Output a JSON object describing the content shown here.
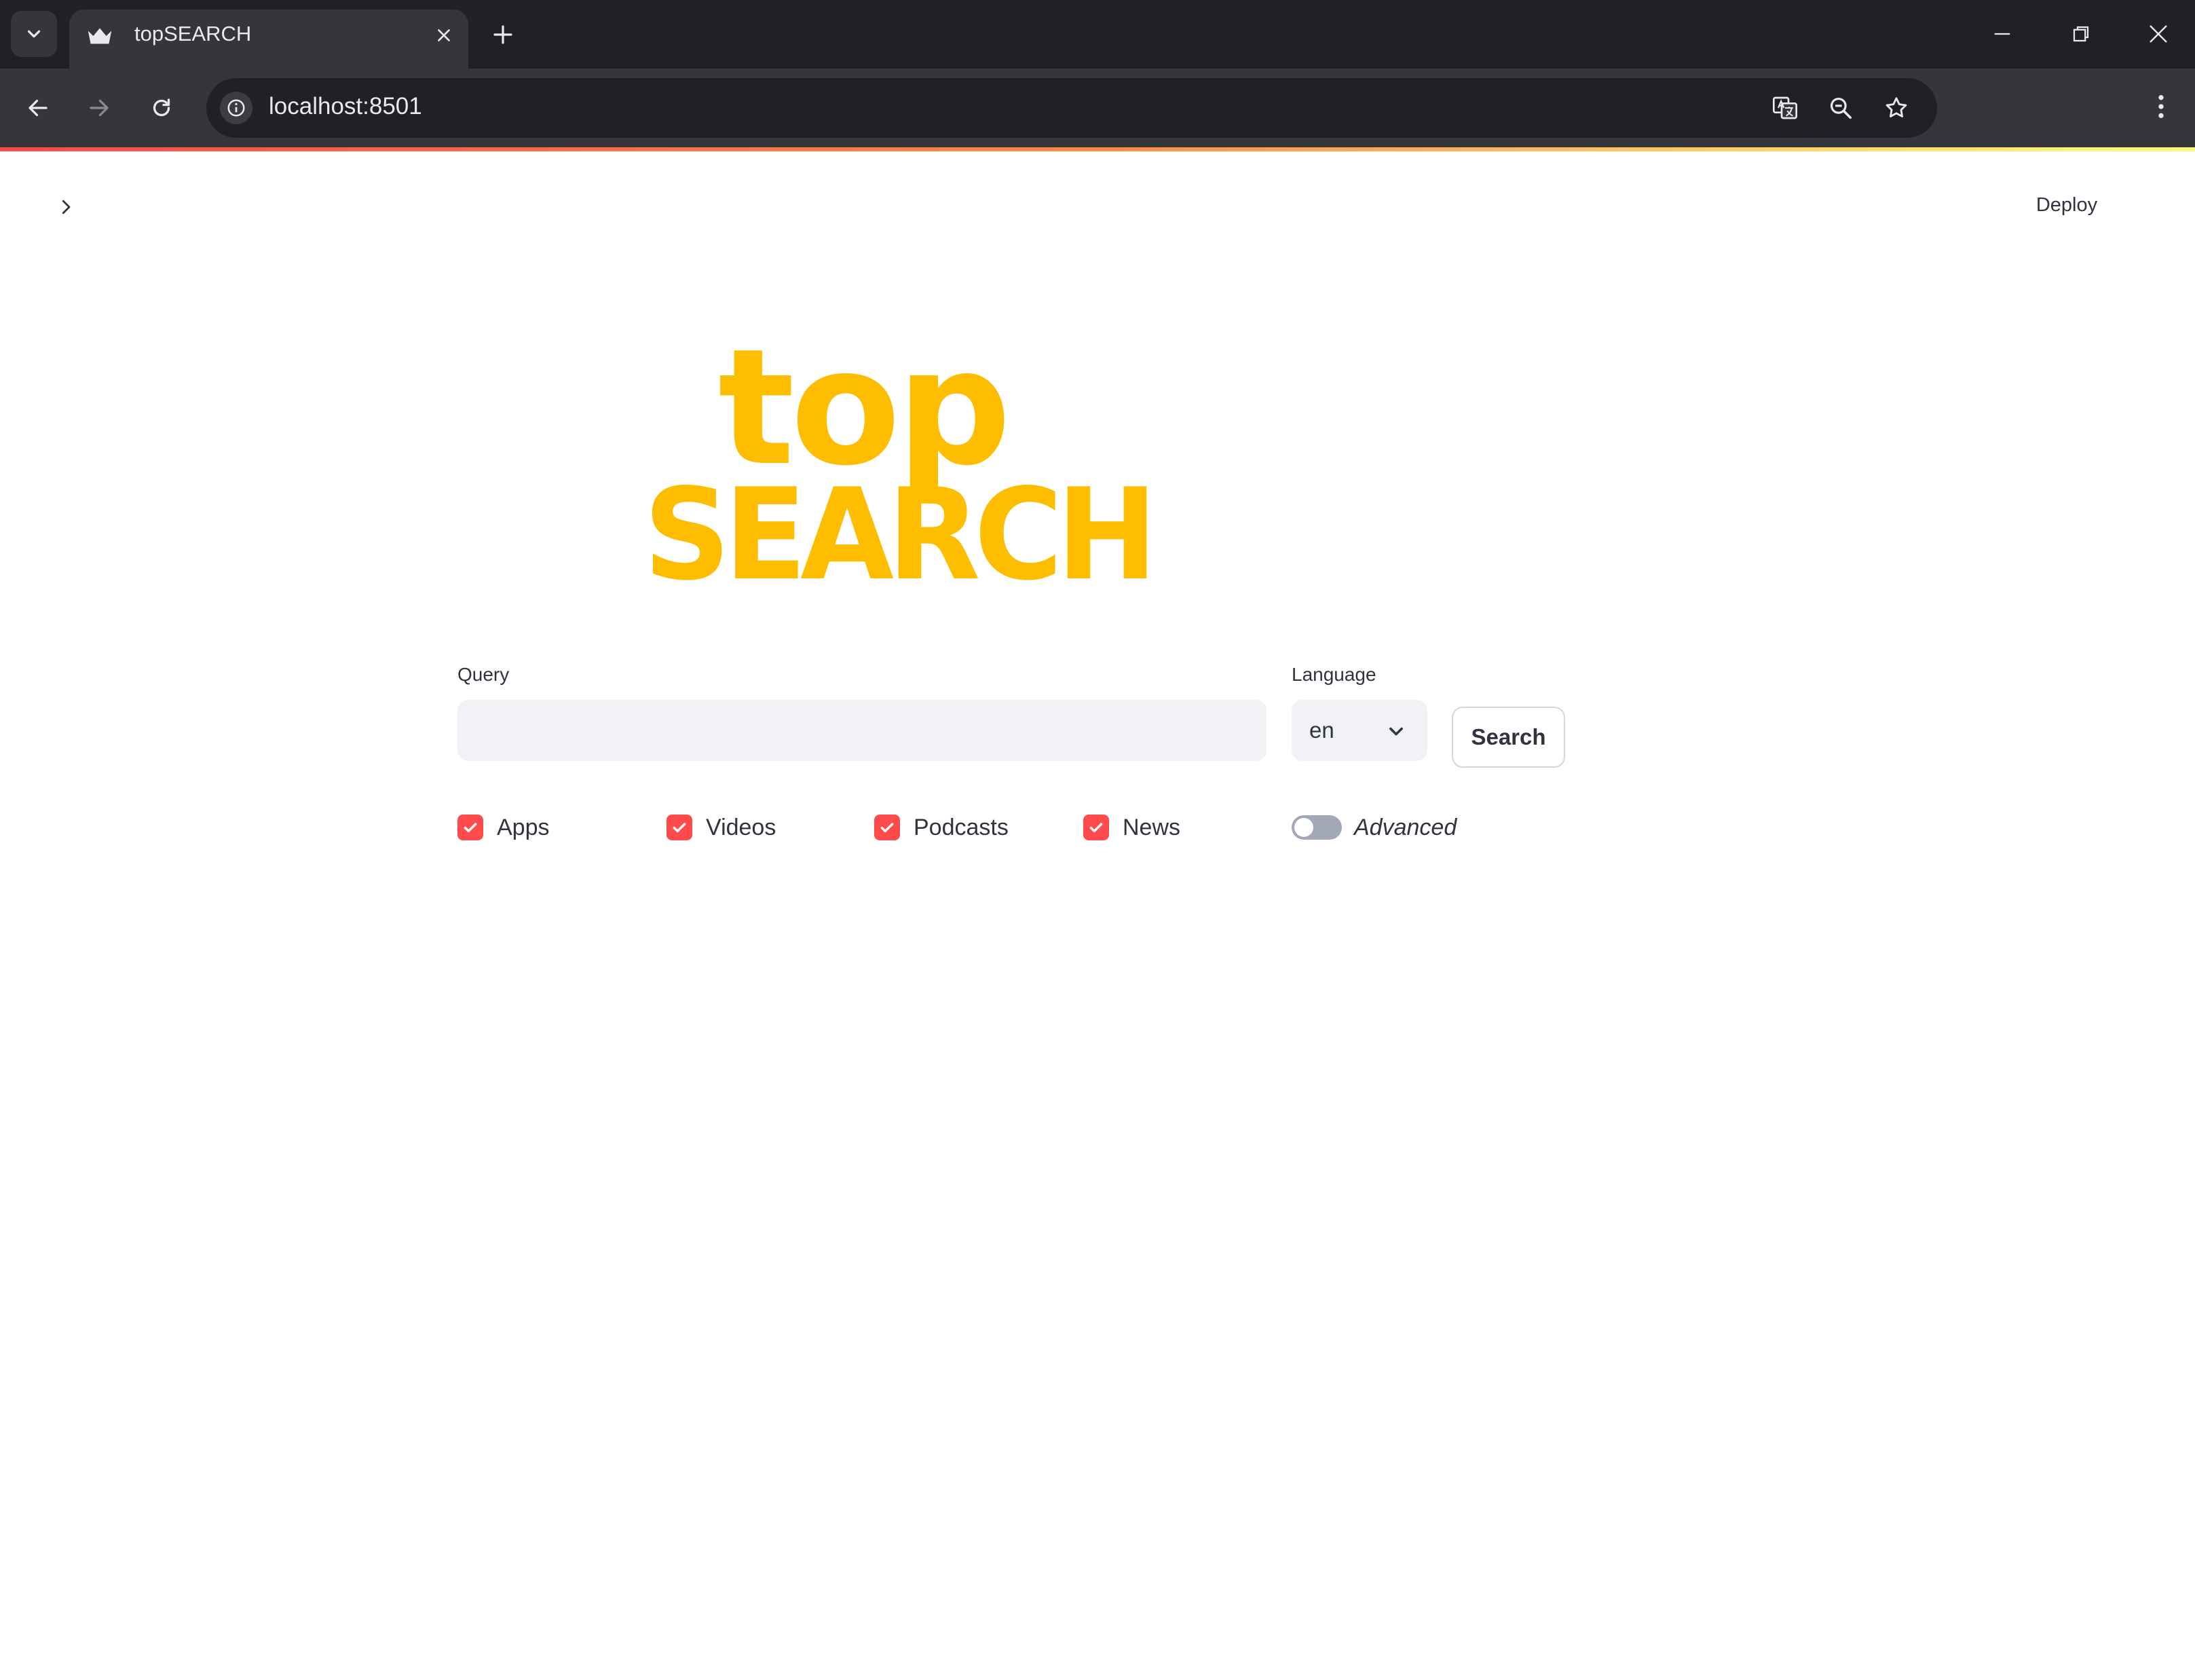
{
  "browser": {
    "tab_title": "topSEARCH",
    "url": "localhost:8501",
    "icons": [
      "tab-search-icon",
      "crown-favicon-icon",
      "close-icon",
      "plus-icon",
      "minimize-icon",
      "restore-icon",
      "window-close-icon",
      "back-arrow-icon",
      "forward-arrow-icon",
      "reload-icon",
      "info-icon",
      "translate-icon",
      "zoom-icon",
      "star-icon",
      "more-vert-icon"
    ]
  },
  "app": {
    "deploy_label": "Deploy",
    "logo": {
      "line1": "top",
      "line2": "SEARCH",
      "color": "#ffbd00"
    },
    "query": {
      "label": "Query",
      "value": "",
      "placeholder": ""
    },
    "language": {
      "label": "Language",
      "value": "en"
    },
    "search_label": "Search",
    "filters": [
      {
        "label": "Apps",
        "checked": true
      },
      {
        "label": "Videos",
        "checked": true
      },
      {
        "label": "Podcasts",
        "checked": true
      },
      {
        "label": "News",
        "checked": true
      }
    ],
    "advanced": {
      "label": "Advanced",
      "on": false
    },
    "colors": {
      "accent": "#ff4b4b",
      "text": "#31333f",
      "input_bg": "#f0f2f6"
    }
  }
}
